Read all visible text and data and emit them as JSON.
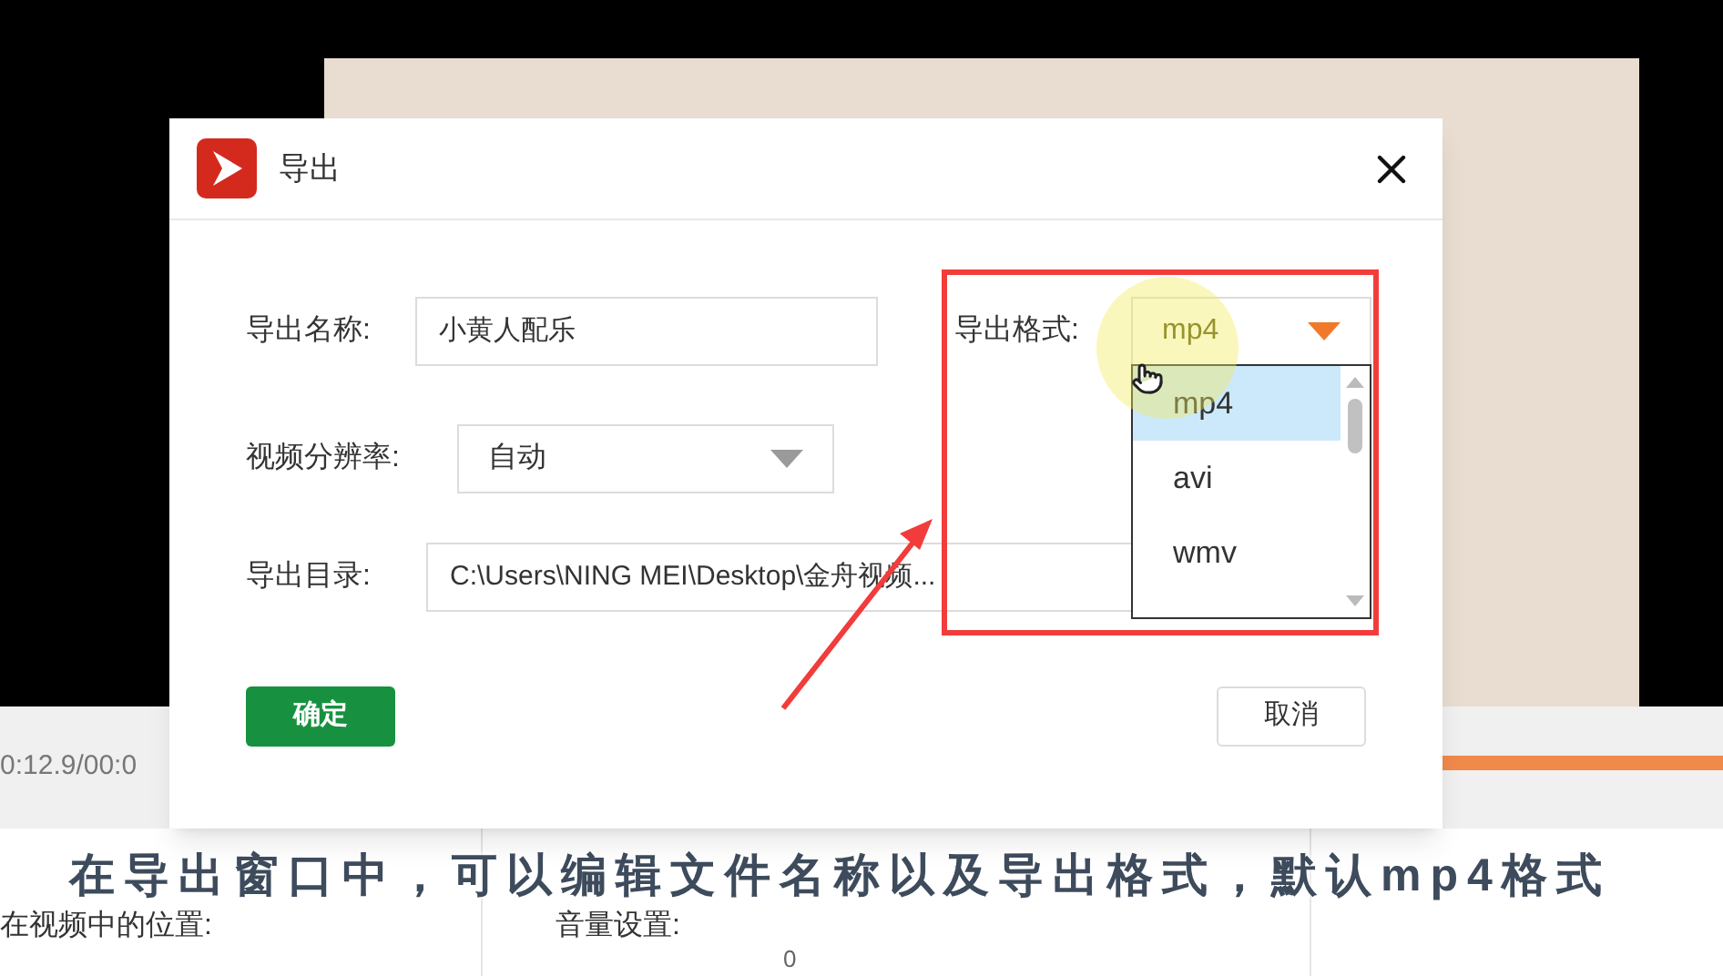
{
  "dialog": {
    "title": "导出",
    "fields": [
      {
        "label": "导出名称:",
        "kind": "input",
        "value": "小黄人配乐"
      },
      {
        "label": "视频分辨率:",
        "kind": "select",
        "value": "自动"
      },
      {
        "label": "导出目录:",
        "kind": "input",
        "value": "C:\\Users\\NING MEI\\Desktop\\金舟视频..."
      }
    ],
    "format": {
      "label": "导出格式:",
      "value": "mp4",
      "expanded": true,
      "options": [
        {
          "label": "mp4",
          "selected": true
        },
        {
          "label": "avi",
          "selected": false
        },
        {
          "label": "wmv",
          "selected": false
        }
      ]
    },
    "buttons": [
      {
        "label": "确定",
        "kind": "primary"
      },
      {
        "label": "取消",
        "kind": "secondary"
      }
    ]
  },
  "timeline": {
    "time": "0:12.9/00:0"
  },
  "panels": [
    {
      "label": "在视频中的位置:"
    },
    {
      "label": "音量设置:",
      "value": "0"
    }
  ],
  "caption": "在导出窗口中，可以编辑文件名称以及导出格式，默认mp4格式"
}
